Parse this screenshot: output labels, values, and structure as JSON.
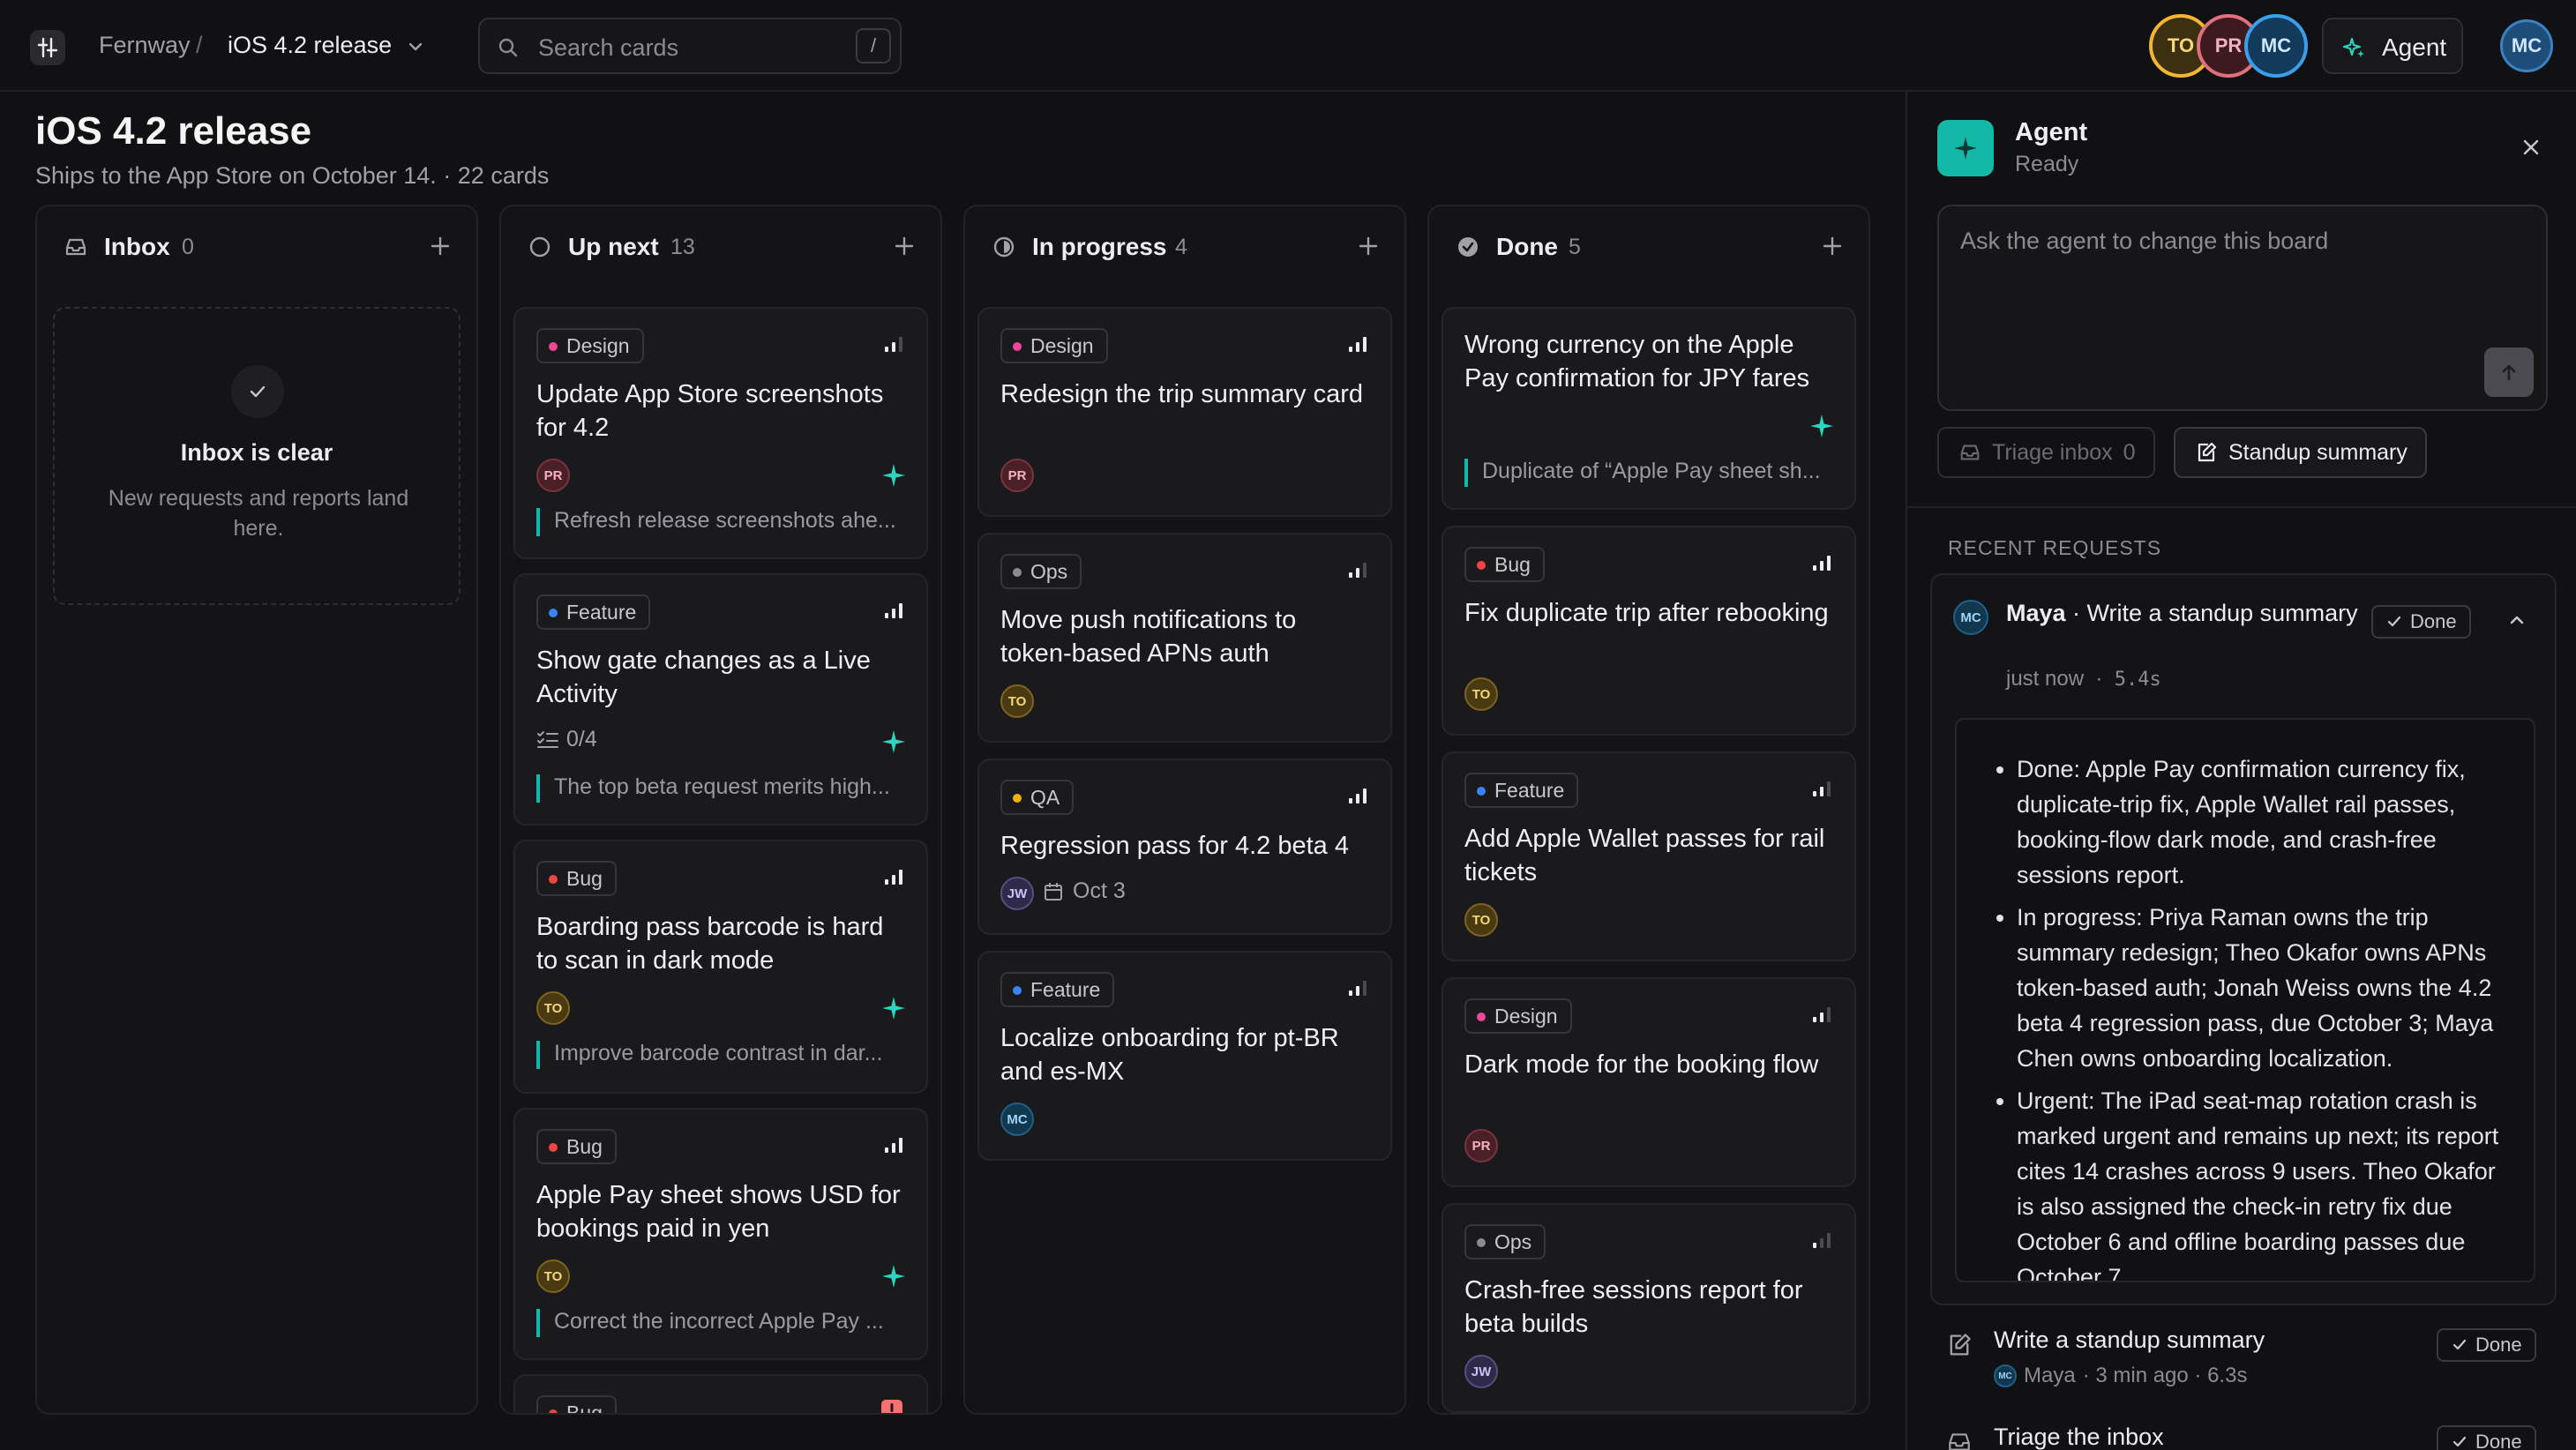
{
  "header": {
    "workspace": "Fernway",
    "separator": "/",
    "board_name": "iOS 4.2 release",
    "search_placeholder": "Search cards",
    "search_shortcut": "/",
    "presence": [
      {
        "initials": "TO",
        "color": "#f2b632"
      },
      {
        "initials": "PR",
        "color": "#e0707e"
      },
      {
        "initials": "MC",
        "color": "#3b9ee8"
      }
    ],
    "agent_button": "Agent",
    "current_user": "MC"
  },
  "board": {
    "title": "iOS 4.2 release",
    "subtitle": "Ships to the App Store on October 14. · 22 cards"
  },
  "columns": [
    {
      "title": "Inbox",
      "count": "0",
      "empty_title": "Inbox is clear",
      "empty_desc": "New requests and reports land here."
    },
    {
      "title": "Up next",
      "count": "13",
      "cards": [
        {
          "tag": "Design",
          "title": "Update App Store screenshots for 4.2",
          "assignee": "PR",
          "note": "Refresh release screenshots ahe..."
        },
        {
          "tag": "Feature",
          "title": "Show gate changes as a Live Activity",
          "checklist": "0/4",
          "note": "The top beta request merits high..."
        },
        {
          "tag": "Bug",
          "title": "Boarding pass barcode is hard to scan in dark mode",
          "assignee": "TO",
          "note": "Improve barcode contrast in dar..."
        },
        {
          "tag": "Bug",
          "title": "Apple Pay sheet shows USD for bookings paid in yen",
          "assignee": "TO",
          "note": "Correct the incorrect Apple Pay ..."
        },
        {
          "tag": "Bug"
        }
      ]
    },
    {
      "title": "In progress",
      "count": "4",
      "cards": [
        {
          "tag": "Design",
          "title": "Redesign the trip summary card",
          "assignee": "PR"
        },
        {
          "tag": "Ops",
          "title": "Move push notifications to token-based APNs auth",
          "assignee": "TO"
        },
        {
          "tag": "QA",
          "title": "Regression pass for 4.2 beta 4",
          "assignee": "JW",
          "due": "Oct 3"
        },
        {
          "tag": "Feature",
          "title": "Localize onboarding for pt-BR and es-MX",
          "assignee": "MC"
        }
      ]
    },
    {
      "title": "Done",
      "count": "5",
      "cards": [
        {
          "title": "Wrong currency on the Apple Pay confirmation for JPY fares",
          "note": "Duplicate of “Apple Pay sheet sh..."
        },
        {
          "tag": "Bug",
          "title": "Fix duplicate trip after rebooking",
          "assignee": "TO"
        },
        {
          "tag": "Feature",
          "title": "Add Apple Wallet passes for rail tickets",
          "assignee": "TO"
        },
        {
          "tag": "Design",
          "title": "Dark mode for the booking flow",
          "assignee": "PR"
        },
        {
          "tag": "Ops",
          "title": "Crash-free sessions report for beta builds",
          "assignee": "JW"
        }
      ]
    }
  ],
  "tag_colors": {
    "Design": "#ec4899",
    "Feature": "#3b82f6",
    "Bug": "#ef4444",
    "Ops": "#8b8b93",
    "QA": "#eab308"
  },
  "agent": {
    "name": "Agent",
    "status": "Ready",
    "prompt_placeholder": "Ask the agent to change this board",
    "chips": [
      {
        "label": "Triage inbox",
        "count": "0"
      },
      {
        "label": "Standup summary"
      }
    ],
    "recent_label": "RECENT REQUESTS",
    "current_request": {
      "user_initials": "MC",
      "user": "Maya",
      "title_sep": " · ",
      "title": "Write a standup summary",
      "time": "just now",
      "dot": "·",
      "duration": "5.4s",
      "status": "Done",
      "summary": [
        "Done: Apple Pay confirmation currency fix, duplicate-trip fix, Apple Wallet rail passes, booking-flow dark mode, and crash-free sessions report.",
        "In progress: Priya Raman owns the trip summary redesign; Theo Okafor owns APNs token-based auth; Jonah Weiss owns the 4.2 beta 4 regression pass, due October 3; Maya Chen owns onboarding localization.",
        "Urgent: The iPad seat-map rotation crash is marked urgent and remains up next; its report cites 14 crashes across 9 users. Theo Okafor is also assigned the check-in retry fix due October 6 and offline boarding passes due October 7."
      ]
    },
    "history": [
      {
        "title": "Write a standup summary",
        "user_initials": "MC",
        "user": "Maya",
        "meta": "· 3 min ago · 6.3s",
        "status": "Done"
      },
      {
        "title": "Triage the inbox",
        "status": "Done"
      }
    ]
  }
}
